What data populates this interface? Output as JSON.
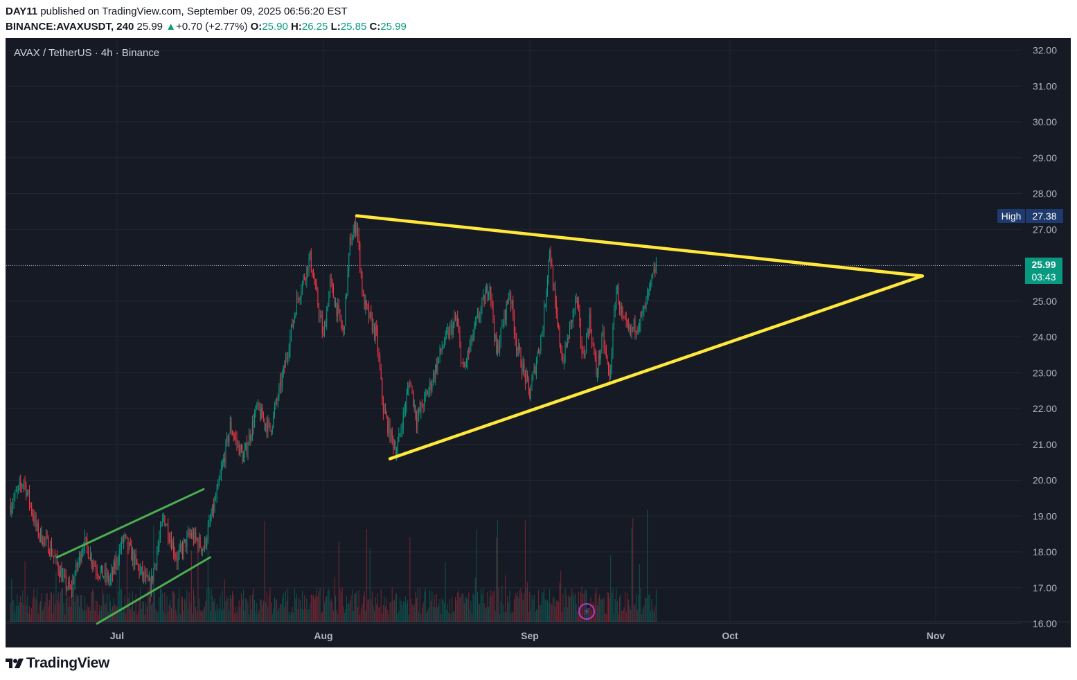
{
  "header": {
    "publisher": "DAY11",
    "published_text": "published on TradingView.com, September 09, 2025 06:56:20 EST",
    "symbol": "BINANCE:AVAXUSDT, 240",
    "last": "25.99",
    "arrow": "▲",
    "change": "+0.70 (+2.77%)",
    "o_label": "O:",
    "o_value": "25.90",
    "h_label": "H:",
    "h_value": "26.25",
    "l_label": "L:",
    "l_value": "25.85",
    "c_label": "C:",
    "c_value": "25.99"
  },
  "chart": {
    "symbol_title": "AVAX / TetherUS · 4h · Binance",
    "high_label": "High",
    "high_value": "27.38",
    "price_label": "25.99",
    "countdown": "03:43",
    "lightning_icon": "⚡"
  },
  "footer": {
    "brand": "TradingView"
  },
  "colors": {
    "background": "#161a25",
    "grid": "#232733",
    "up": "#089981",
    "down": "#f23645",
    "triangle": "#ffe83b",
    "channel": "#4caf50",
    "axis_text": "#b2b5be",
    "high_badge": "#1f3a6e"
  },
  "chart_data": {
    "type": "candlestick",
    "title": "AVAX / TetherUS · 4h · Binance",
    "y_axis": {
      "side": "right",
      "range": [
        16.0,
        32.3
      ],
      "ticks": [
        "16.00",
        "17.00",
        "18.00",
        "19.00",
        "20.00",
        "21.00",
        "22.00",
        "23.00",
        "24.00",
        "25.00",
        "26.00",
        "27.00",
        "28.00",
        "29.00",
        "30.00",
        "31.00",
        "32.00"
      ]
    },
    "x_axis": {
      "ticks": [
        "Jul",
        "Aug",
        "Sep",
        "Oct",
        "Nov"
      ],
      "range": [
        "2025-06-15",
        "2025-11-17"
      ]
    },
    "grid": true,
    "last_price": 25.99,
    "high_marker": 27.38,
    "series_waypoints": [
      {
        "date": "2025-06-15",
        "price": 19.3
      },
      {
        "date": "2025-06-17",
        "price": 20.0
      },
      {
        "date": "2025-06-19",
        "price": 18.6
      },
      {
        "date": "2025-06-21",
        "price": 18.1
      },
      {
        "date": "2025-06-23",
        "price": 17.2
      },
      {
        "date": "2025-06-24",
        "price": 16.9
      },
      {
        "date": "2025-06-26",
        "price": 18.3
      },
      {
        "date": "2025-06-28",
        "price": 17.5
      },
      {
        "date": "2025-06-30",
        "price": 17.2
      },
      {
        "date": "2025-07-02",
        "price": 18.4
      },
      {
        "date": "2025-07-04",
        "price": 17.6
      },
      {
        "date": "2025-07-06",
        "price": 17.0
      },
      {
        "date": "2025-07-08",
        "price": 19.0
      },
      {
        "date": "2025-07-10",
        "price": 17.8
      },
      {
        "date": "2025-07-12",
        "price": 18.5
      },
      {
        "date": "2025-07-14",
        "price": 18.1
      },
      {
        "date": "2025-07-16",
        "price": 19.6
      },
      {
        "date": "2025-07-18",
        "price": 21.5
      },
      {
        "date": "2025-07-20",
        "price": 20.6
      },
      {
        "date": "2025-07-22",
        "price": 22.0
      },
      {
        "date": "2025-07-24",
        "price": 21.4
      },
      {
        "date": "2025-07-26",
        "price": 23.0
      },
      {
        "date": "2025-07-28",
        "price": 25.0
      },
      {
        "date": "2025-07-30",
        "price": 26.2
      },
      {
        "date": "2025-08-01",
        "price": 24.0
      },
      {
        "date": "2025-08-02",
        "price": 25.5
      },
      {
        "date": "2025-08-04",
        "price": 24.1
      },
      {
        "date": "2025-08-05",
        "price": 26.6
      },
      {
        "date": "2025-08-06",
        "price": 27.2
      },
      {
        "date": "2025-08-07",
        "price": 25.0
      },
      {
        "date": "2025-08-09",
        "price": 24.0
      },
      {
        "date": "2025-08-10",
        "price": 22.0
      },
      {
        "date": "2025-08-11",
        "price": 21.3
      },
      {
        "date": "2025-08-12",
        "price": 20.8
      },
      {
        "date": "2025-08-14",
        "price": 22.8
      },
      {
        "date": "2025-08-15",
        "price": 21.7
      },
      {
        "date": "2025-08-17",
        "price": 22.6
      },
      {
        "date": "2025-08-19",
        "price": 23.8
      },
      {
        "date": "2025-08-21",
        "price": 24.5
      },
      {
        "date": "2025-08-22",
        "price": 23.0
      },
      {
        "date": "2025-08-24",
        "price": 24.4
      },
      {
        "date": "2025-08-26",
        "price": 25.5
      },
      {
        "date": "2025-08-27",
        "price": 23.5
      },
      {
        "date": "2025-08-29",
        "price": 25.3
      },
      {
        "date": "2025-08-30",
        "price": 23.8
      },
      {
        "date": "2025-09-01",
        "price": 22.4
      },
      {
        "date": "2025-09-03",
        "price": 24.3
      },
      {
        "date": "2025-09-04",
        "price": 26.5
      },
      {
        "date": "2025-09-05",
        "price": 24.5
      },
      {
        "date": "2025-09-06",
        "price": 23.3
      },
      {
        "date": "2025-09-08",
        "price": 25.1
      },
      {
        "date": "2025-09-09",
        "price": 23.4
      },
      {
        "date": "2025-09-10",
        "price": 24.5
      },
      {
        "date": "2025-09-11",
        "price": 23.0
      },
      {
        "date": "2025-09-12",
        "price": 24.0
      },
      {
        "date": "2025-09-13",
        "price": 22.8
      },
      {
        "date": "2025-09-14",
        "price": 25.4
      },
      {
        "date": "2025-09-15",
        "price": 24.4
      },
      {
        "date": "2025-09-16",
        "price": 24.1
      },
      {
        "date": "2025-09-18",
        "price": 24.6
      },
      {
        "date": "2025-09-20",
        "price": 25.99
      }
    ],
    "drawings": [
      {
        "type": "line",
        "color": "#ffe83b",
        "from": {
          "date": "2025-08-06",
          "price": 27.38
        },
        "to": {
          "date": "2025-10-30",
          "price": 25.7
        }
      },
      {
        "type": "line",
        "color": "#ffe83b",
        "from": {
          "date": "2025-08-11",
          "price": 20.6
        },
        "to": {
          "date": "2025-10-30",
          "price": 25.7
        }
      },
      {
        "type": "line",
        "color": "#4caf50",
        "from": {
          "date": "2025-06-22",
          "price": 17.85
        },
        "to": {
          "date": "2025-07-14",
          "price": 19.75
        }
      },
      {
        "type": "line",
        "color": "#4caf50",
        "from": {
          "date": "2025-06-28",
          "price": 16.0
        },
        "to": {
          "date": "2025-07-15",
          "price": 17.85
        }
      }
    ]
  }
}
